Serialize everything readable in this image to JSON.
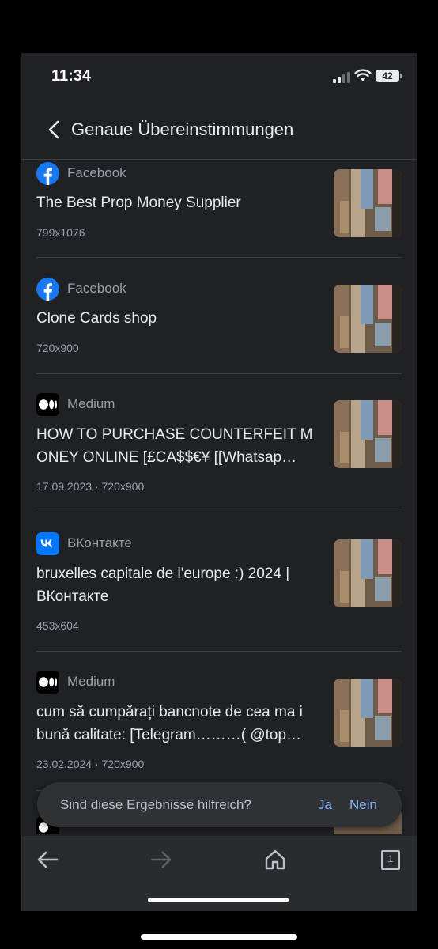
{
  "status_bar": {
    "time": "11:34",
    "battery": "42"
  },
  "header": {
    "title": "Genaue Übereinstimmungen"
  },
  "results": [
    {
      "source": "Facebook",
      "icon": "facebook-icon",
      "title": "The Best Prop Money Supplier",
      "meta": "799x1076"
    },
    {
      "source": "Facebook",
      "icon": "facebook-icon",
      "title": "Clone Cards shop",
      "meta": "720x900"
    },
    {
      "source": "Medium",
      "icon": "medium-icon",
      "title": "HOW TO PURCHASE COUNTERFEIT M ONEY ONLINE [£CA$$€¥ [[Whatsap…",
      "meta": "17.09.2023 · 720x900"
    },
    {
      "source": "ВКонтакте",
      "icon": "vk-icon",
      "title": "bruxelles capitale de l'europe :) 2024 | ВКонтакте",
      "meta": "453x604"
    },
    {
      "source": "Medium",
      "icon": "medium-icon",
      "title": "cum să cumpărați bancnote de cea ma i bună calitate: [Telegram………( @top…",
      "meta": "23.02.2024 · 720x900"
    }
  ],
  "feedback": {
    "question": "Sind diese Ergebnisse hilfreich?",
    "yes": "Ja",
    "no": "Nein"
  },
  "bottom_nav": {
    "tabs_count": "1"
  },
  "colors": {
    "background": "#202124",
    "accent": "#8ab4f8",
    "facebook": "#1877f2",
    "vk": "#0077ff"
  }
}
